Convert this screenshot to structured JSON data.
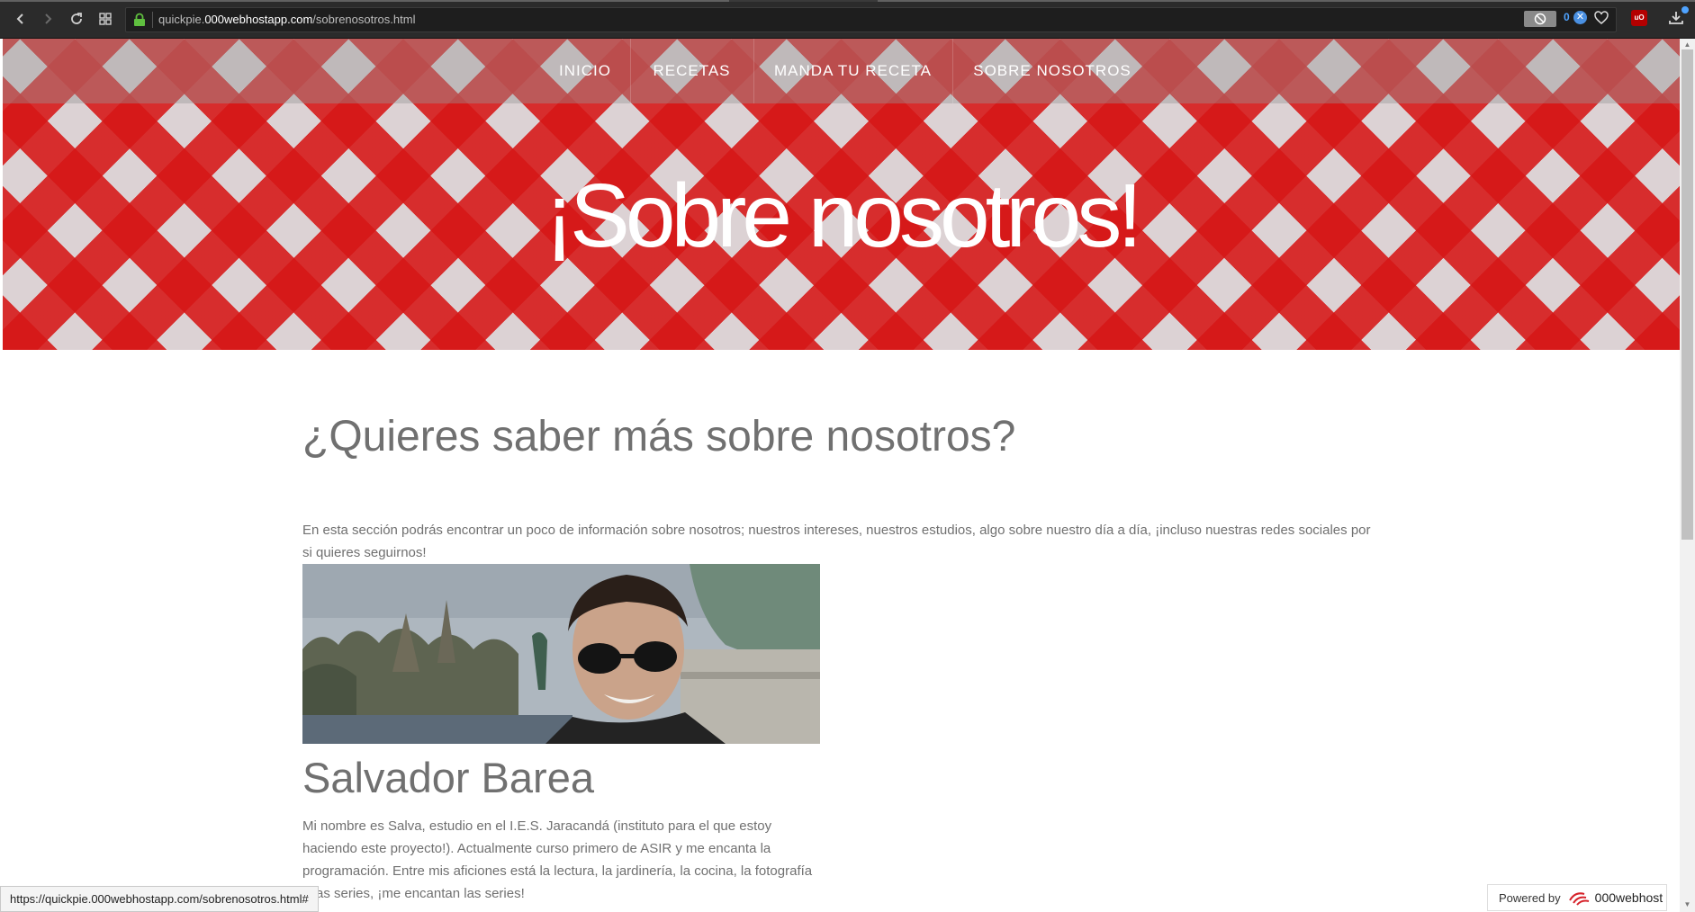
{
  "browser": {
    "url_prefix": "quickpie.",
    "url_domain": "000webhostapp.com",
    "url_path": "/sobrenosotros.html",
    "badge_count": "0",
    "status_url": "https://quickpie.000webhostapp.com/sobrenosotros.html#",
    "icons": [
      "back-icon",
      "forward-icon",
      "reload-icon",
      "apps-grid-icon",
      "lock-icon",
      "blocker-icon",
      "heart-icon",
      "ublock-icon",
      "download-icon"
    ]
  },
  "nav": {
    "items": [
      {
        "label": "INICIO"
      },
      {
        "label": "RECETAS"
      },
      {
        "label": "MANDA TU RECETA"
      },
      {
        "label": "SOBRE NOSOTROS"
      }
    ]
  },
  "hero": {
    "title": "¡Sobre nosotros!",
    "pattern_colors": [
      "#d61616",
      "#dcd2d4"
    ]
  },
  "main": {
    "section_title": "¿Quieres saber más sobre nosotros?",
    "intro": "En esta sección podrás encontrar un poco de información sobre nosotros; nuestros intereses, nuestros estudios, algo sobre nuestro día a día, ¡incluso nuestras redes sociales por si quieres seguirnos!",
    "person": {
      "name": "Salvador Barea",
      "bio": "Mi nombre es Salva, estudio en el I.E.S. Jaracandá (instituto para el que estoy haciendo este proyecto!). Actualmente curso primero de ASIR y me encanta la programación. Entre mis aficiones está la lectura, la jardinería, la cocina, la fotografía y las series, ¡me encantan las series!"
    }
  },
  "footer_badge": {
    "label": "Powered by",
    "brand": "000webhost"
  }
}
